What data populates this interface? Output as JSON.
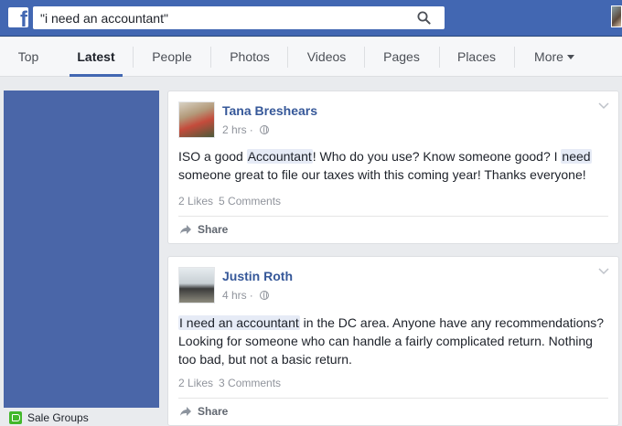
{
  "search": {
    "value": "\"i need an accountant\""
  },
  "logo": {
    "glyph": "f"
  },
  "tabs": [
    {
      "label": "Top"
    },
    {
      "label": "Latest"
    },
    {
      "label": "People"
    },
    {
      "label": "Photos"
    },
    {
      "label": "Videos"
    },
    {
      "label": "Pages"
    },
    {
      "label": "Places"
    },
    {
      "label": "More"
    }
  ],
  "active_tab": "Latest",
  "sidebar": {
    "sale_groups_label": "Sale Groups"
  },
  "posts": [
    {
      "author": "Tana Breshears",
      "time": "2 hrs",
      "text_parts": [
        "ISO a good ",
        "Accountant",
        "! Who do you use? Know someone good? I ",
        "need",
        " someone great to file our taxes with this coming year! Thanks everyone!"
      ],
      "likes": "2 Likes",
      "comments": "5 Comments",
      "share": "Share"
    },
    {
      "author": "Justin Roth",
      "time": "4 hrs",
      "text_parts": [
        "I need an accountant",
        " in the DC area. Anyone have any recommendations? Looking for someone who can handle a fairly complicated return. Nothing too bad, but not a basic return."
      ],
      "likes": "2 Likes",
      "comments": "3 Comments",
      "share": "Share"
    }
  ],
  "colors": {
    "brand": "#4267b2",
    "link": "#365899",
    "highlight": "#e6ebf6",
    "muted": "#90949c"
  },
  "icons": {
    "search": "search-icon",
    "globe": "globe-icon",
    "share": "share-icon",
    "chevron": "chevron-down-icon"
  }
}
